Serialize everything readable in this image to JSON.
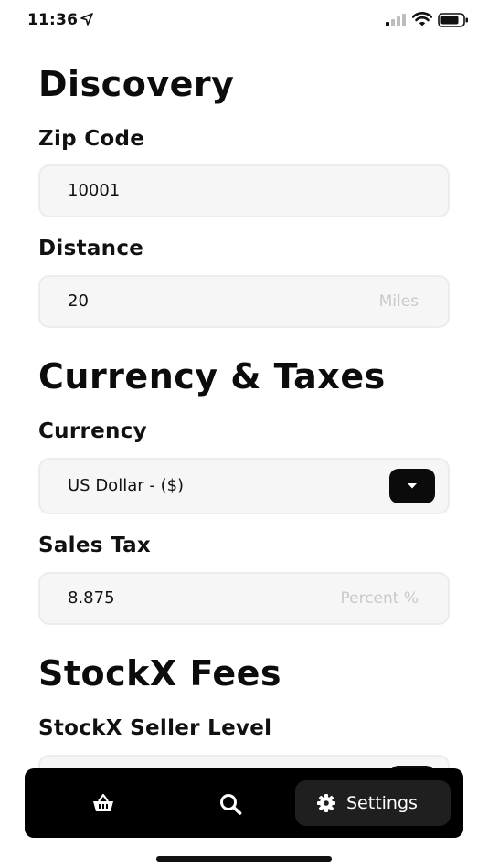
{
  "status_bar": {
    "time": "11:36",
    "icons": [
      "location-arrow-icon",
      "signal-icon",
      "wifi-icon",
      "battery-icon"
    ]
  },
  "discovery": {
    "title": "Discovery",
    "zip_code": {
      "label": "Zip Code",
      "value": "10001"
    },
    "distance": {
      "label": "Distance",
      "value": "20",
      "unit": "Miles"
    }
  },
  "currency_taxes": {
    "title": "Currency & Taxes",
    "currency": {
      "label": "Currency",
      "value": "US Dollar - ($)"
    },
    "sales_tax": {
      "label": "Sales Tax",
      "value": "8.875",
      "unit": "Percent %"
    }
  },
  "stockx_fees": {
    "title": "StockX Fees",
    "seller_level": {
      "label": "StockX Seller Level"
    }
  },
  "tab_bar": {
    "items": [
      {
        "icon": "basket-icon"
      },
      {
        "icon": "search-icon"
      },
      {
        "icon": "gear-icon",
        "label": "Settings",
        "active": true
      }
    ]
  },
  "colors": {
    "accent": "#000000",
    "field_background": "#f6f6f6",
    "placeholder_text": "#c9c9c9"
  }
}
